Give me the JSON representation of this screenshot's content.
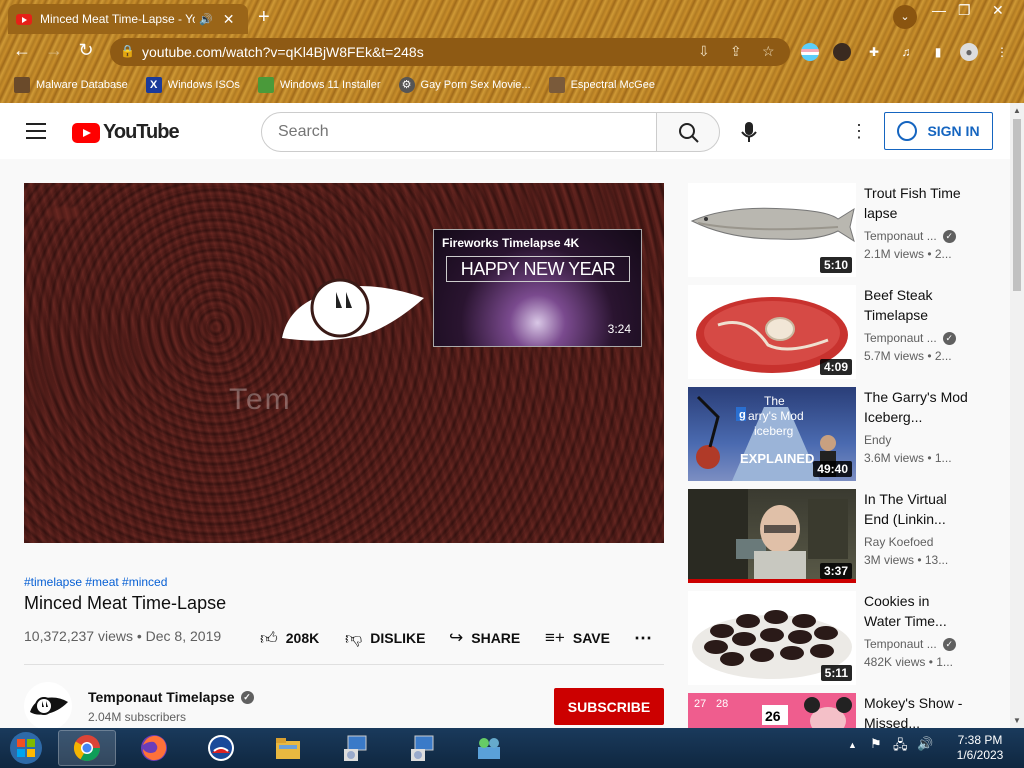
{
  "browser": {
    "tab_title": "Minced Meat Time-Lapse - YouTube",
    "new_tab": "+",
    "url": "youtube.com/watch?v=qKl4BjW8FEk&t=248s",
    "bookmarks": [
      {
        "label": "Malware Database"
      },
      {
        "label": "Windows ISOs"
      },
      {
        "label": "Windows 11 Installer"
      },
      {
        "label": "Gay Porn Sex Movie..."
      },
      {
        "label": "Espectral McGee"
      }
    ]
  },
  "youtube": {
    "logo_text": "YouTube",
    "search_placeholder": "Search",
    "sign_in": "SIGN IN"
  },
  "player": {
    "watermark": "Tem",
    "endcard_title": "Fireworks Timelapse 4K",
    "endcard_banner": "HAPPY NEW YEAR",
    "endcard_duration": "3:24"
  },
  "video": {
    "tags": "#timelapse #meat #minced",
    "title": "Minced Meat Time-Lapse",
    "stats": "10,372,237 views • Dec 8, 2019",
    "likes": "208K",
    "dislike": "DISLIKE",
    "share": "SHARE",
    "save": "SAVE"
  },
  "channel": {
    "name": "Temponaut Timelapse",
    "subscribers": "2.04M subscribers",
    "subscribe": "SUBSCRIBE"
  },
  "recommendations": [
    {
      "title": "Trout Fish Time lapse",
      "channel": "Temponaut ...",
      "verified": true,
      "meta": "2.1M views • 2...",
      "duration": "5:10"
    },
    {
      "title": "Beef Steak Timelapse",
      "channel": "Temponaut ...",
      "verified": true,
      "meta": "5.7M views • 2...",
      "duration": "4:09"
    },
    {
      "title": "The Garry's Mod Iceberg...",
      "channel": "Endy",
      "verified": false,
      "meta": "3.6M views • 1...",
      "duration": "49:40",
      "thumb_text_1": "The",
      "thumb_text_2": "arry's Mod",
      "thumb_text_3": "iceberg",
      "thumb_text_4": "EXPLAINED"
    },
    {
      "title": "In The Virtual End (Linkin...",
      "channel": "Ray Koefoed",
      "verified": false,
      "meta": "3M views • 13...",
      "duration": "3:37"
    },
    {
      "title": "Cookies in Water Time...",
      "channel": "Temponaut ...",
      "verified": true,
      "meta": "482K views • 1...",
      "duration": "5:11"
    },
    {
      "title": "Mokey's Show - Missed...",
      "channel": "",
      "verified": false,
      "meta": "",
      "duration": "",
      "thumb_text_1": "26",
      "thumb_text_2": "27",
      "thumb_text_3": "28"
    }
  ],
  "taskbar": {
    "time": "7:38 PM",
    "date": "1/6/2023"
  },
  "colors": {
    "youtube_red": "#ff0000",
    "subscribe_red": "#cc0000",
    "link_blue": "#065fd4",
    "signin_blue": "#1565c0"
  }
}
